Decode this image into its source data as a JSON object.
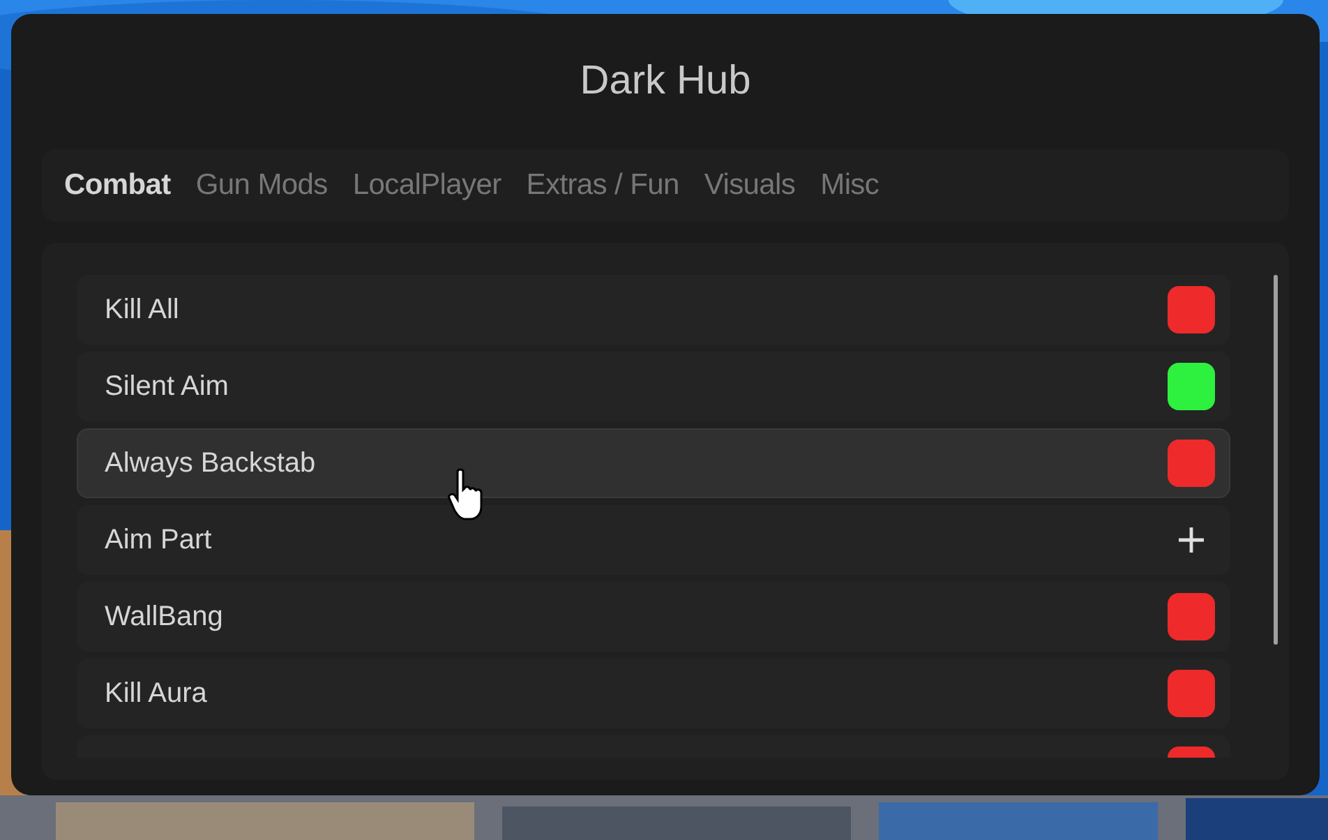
{
  "window": {
    "title": "Dark Hub"
  },
  "tabs": [
    {
      "label": "Combat",
      "selected": true
    },
    {
      "label": "Gun Mods",
      "selected": false
    },
    {
      "label": "LocalPlayer",
      "selected": false
    },
    {
      "label": "Extras / Fun",
      "selected": false
    },
    {
      "label": "Visuals",
      "selected": false
    },
    {
      "label": "Misc",
      "selected": false
    }
  ],
  "options": [
    {
      "kind": "toggle",
      "label": "Kill All",
      "on": false,
      "hovered": false
    },
    {
      "kind": "toggle",
      "label": "Silent Aim",
      "on": true,
      "hovered": false
    },
    {
      "kind": "toggle",
      "label": "Always Backstab",
      "on": false,
      "hovered": true
    },
    {
      "kind": "dropdown",
      "label": "Aim Part",
      "hovered": false
    },
    {
      "kind": "toggle",
      "label": "WallBang",
      "on": false,
      "hovered": false
    },
    {
      "kind": "toggle",
      "label": "Kill Aura",
      "on": false,
      "hovered": false
    },
    {
      "kind": "toggle",
      "on": false,
      "hovered": false
    }
  ]
}
